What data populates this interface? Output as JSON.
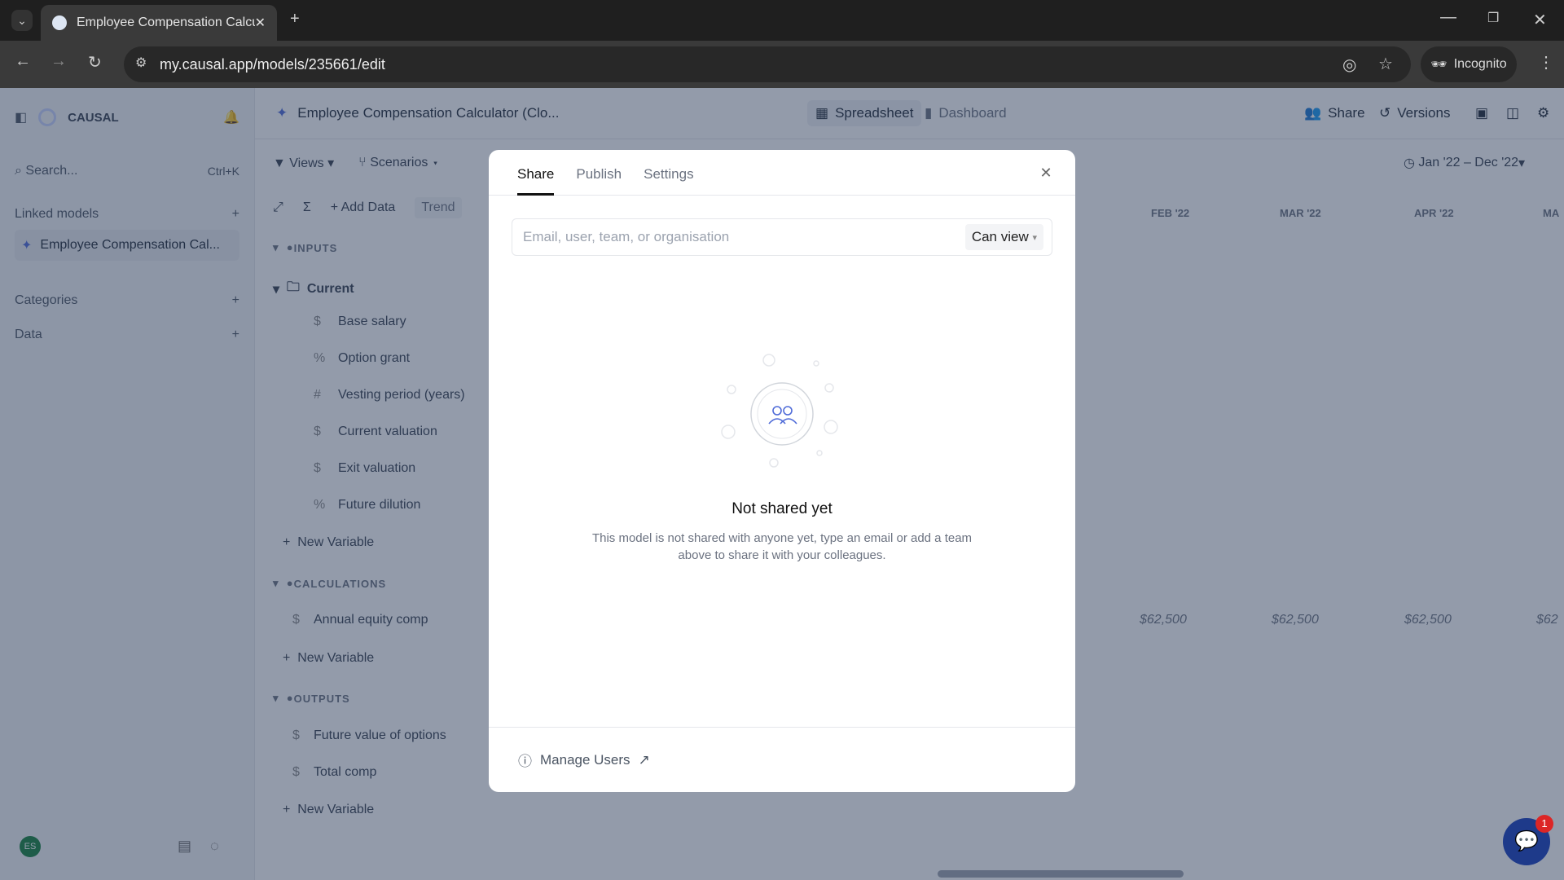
{
  "browser": {
    "tab_title": "Employee Compensation Calcul",
    "url": "my.causal.app/models/235661/edit",
    "incognito_label": "Incognito"
  },
  "sidebar": {
    "brand": "CAUSAL",
    "search_placeholder": "Search...",
    "search_shortcut": "Ctrl+K",
    "linked_models_label": "Linked models",
    "linked_model": "Employee Compensation Cal...",
    "categories_label": "Categories",
    "data_label": "Data",
    "avatar": "ES"
  },
  "header": {
    "model_title": "Employee Compensation Calculator (Clo...",
    "spreadsheet": "Spreadsheet",
    "dashboard": "Dashboard",
    "share": "Share",
    "versions": "Versions"
  },
  "toolbar": {
    "views": "Views",
    "scenarios": "Scenarios",
    "add_data": "Add Data",
    "trend": "Trend",
    "date_range": "Jan '22 – Dec '22"
  },
  "months": [
    "FEB '22",
    "MAR '22",
    "APR '22",
    "MA"
  ],
  "groups": {
    "inputs": "INPUTS",
    "current": "Current",
    "calculations": "CALCULATIONS",
    "outputs": "OUTPUTS",
    "new_variable": "New Variable"
  },
  "inputs": [
    {
      "icon": "$",
      "label": "Base salary"
    },
    {
      "icon": "%",
      "label": "Option grant"
    },
    {
      "icon": "#",
      "label": "Vesting period (years)"
    },
    {
      "icon": "$",
      "label": "Current valuation"
    },
    {
      "icon": "$",
      "label": "Exit valuation"
    },
    {
      "icon": "%",
      "label": "Future dilution"
    }
  ],
  "calculations": [
    {
      "label": "Annual equity comp",
      "values": [
        "$62,500",
        "$62,500",
        "$62,500",
        "$62"
      ]
    }
  ],
  "outputs": [
    {
      "label": "Future value of options"
    },
    {
      "label": "Total comp"
    }
  ],
  "modal": {
    "tabs": [
      "Share",
      "Publish",
      "Settings"
    ],
    "active_tab": "Share",
    "placeholder": "Email, user, team, or organisation",
    "permission": "Can view",
    "empty_title": "Not shared yet",
    "empty_text_1": "This model is not shared with anyone yet, type an email or add a team",
    "empty_text_2": "above to share it with your colleagues.",
    "manage_users": "Manage Users"
  },
  "chat_badge": "1"
}
